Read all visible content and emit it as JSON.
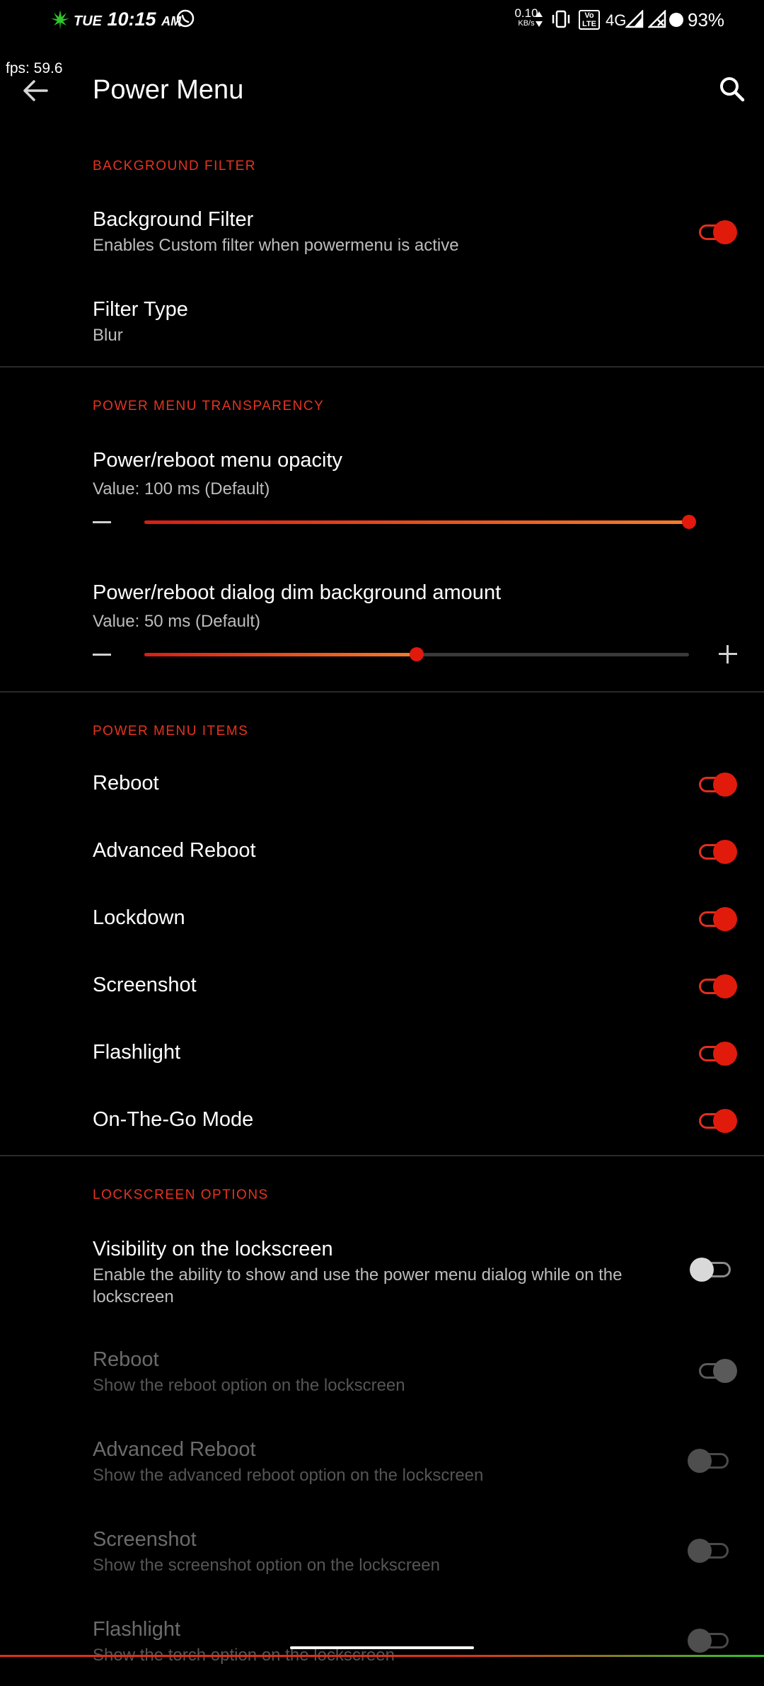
{
  "status_bar": {
    "day": "TUE",
    "time": "10:15",
    "ampm": "AM",
    "net_speed": "0.10",
    "net_unit": "KB/s",
    "volte": "Vo LTE",
    "network": "4G",
    "battery": "93%"
  },
  "fps_overlay": "fps: 59.6",
  "toolbar": {
    "title": "Power Menu"
  },
  "sections": {
    "background_filter": {
      "header": "BACKGROUND FILTER",
      "background_filter": {
        "title": "Background Filter",
        "summary": "Enables Custom filter when powermenu is active",
        "enabled": true
      },
      "filter_type": {
        "title": "Filter Type",
        "summary": "Blur"
      }
    },
    "transparency": {
      "header": "POWER MENU TRANSPARENCY",
      "menu_opacity": {
        "title": "Power/reboot menu opacity",
        "summary": "Value: 100 ms (Default)",
        "level": 1.0
      },
      "dim_amount": {
        "title": "Power/reboot dialog dim background amount",
        "summary": "Value: 50 ms (Default)",
        "level": 0.5
      }
    },
    "items": {
      "header": "POWER MENU ITEMS",
      "list": [
        {
          "label": "Reboot",
          "enabled": true
        },
        {
          "label": "Advanced Reboot",
          "enabled": true
        },
        {
          "label": "Lockdown",
          "enabled": true
        },
        {
          "label": "Screenshot",
          "enabled": true
        },
        {
          "label": "Flashlight",
          "enabled": true
        },
        {
          "label": "On-The-Go Mode",
          "enabled": true
        }
      ]
    },
    "lockscreen": {
      "header": "LOCKSCREEN OPTIONS",
      "visibility": {
        "title": "Visibility on the lockscreen",
        "summary_line1": "Enable the ability to show and use the power menu dialog while on the",
        "summary_line2": "lockscreen",
        "enabled": false
      },
      "options": [
        {
          "title": "Reboot",
          "summary": "Show the reboot option on the lockscreen",
          "enabled": true
        },
        {
          "title": "Advanced Reboot",
          "summary": "Show the advanced reboot option on the lockscreen",
          "enabled": false
        },
        {
          "title": "Screenshot",
          "summary": "Show the screenshot option on the lockscreen",
          "enabled": false
        },
        {
          "title": "Flashlight",
          "summary": "Show the torch option on the lockscreen",
          "enabled": false
        }
      ]
    }
  },
  "colors": {
    "accent": "#e53321",
    "background": "#000000"
  }
}
